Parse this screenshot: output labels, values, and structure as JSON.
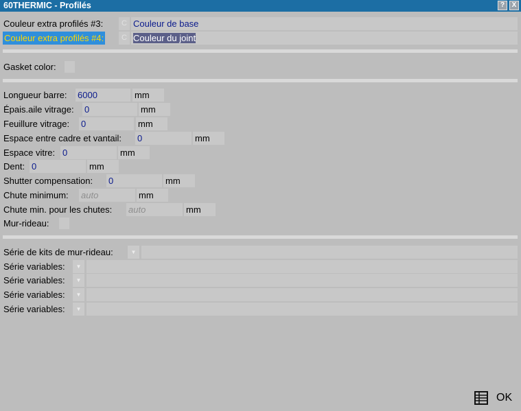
{
  "window": {
    "title": "60THERMIC - Profilés",
    "help_label": "?",
    "close_label": "X"
  },
  "colors_section": {
    "row3": {
      "label": "Couleur extra profilés #3:",
      "button": "C",
      "value": "Couleur de base"
    },
    "row4": {
      "label": "Couleur extra profilés #4:",
      "button": "C",
      "value": "Couleur du joint"
    }
  },
  "gasket": {
    "label": "Gasket color:"
  },
  "dimensions": {
    "longueur": {
      "label": "Longueur barre:",
      "value": "6000",
      "unit": "mm"
    },
    "epais": {
      "label": "Épais.aile vitrage:",
      "value": "0",
      "unit": "mm"
    },
    "feuillure": {
      "label": "Feuillure vitrage:",
      "value": "0",
      "unit": "mm"
    },
    "espace_cadre": {
      "label": "Espace entre cadre et vantail:",
      "value": "0",
      "unit": "mm"
    },
    "espace_vitre": {
      "label": "Espace vitre:",
      "value": "0",
      "unit": "mm"
    },
    "dent": {
      "label": "Dent:",
      "value": "0",
      "unit": "mm"
    },
    "shutter": {
      "label": "Shutter compensation:",
      "value": "0",
      "unit": "mm"
    },
    "chute_min": {
      "label": "Chute minimum:",
      "placeholder": "auto",
      "unit": "mm"
    },
    "chute_min_chutes": {
      "label": "Chute min. pour les chutes:",
      "placeholder": "auto",
      "unit": "mm"
    },
    "mur_rideau": {
      "label": "Mur-rideau:"
    }
  },
  "series": {
    "kits_label": "Série de kits de mur-rideau:",
    "variables": [
      {
        "label": "Série variables:"
      },
      {
        "label": "Série variables:"
      },
      {
        "label": "Série variables:"
      },
      {
        "label": "Série variables:"
      }
    ]
  },
  "footer": {
    "ok_label": "OK",
    "table_icon": "table-icon"
  }
}
